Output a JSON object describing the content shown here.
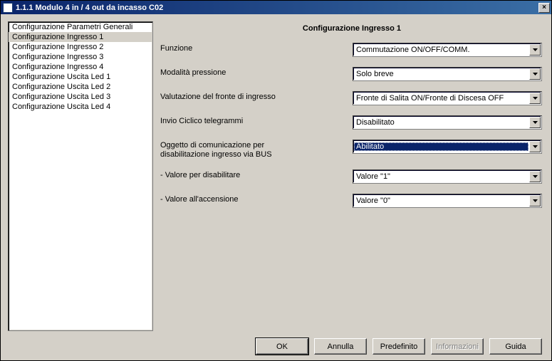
{
  "window": {
    "title": "1.1.1 Modulo 4 in / 4 out da incasso C02",
    "close_icon": "×"
  },
  "sidebar": {
    "selected_index": 1,
    "items": [
      "Configurazione Parametri Generali",
      "Configurazione Ingresso 1",
      "Configurazione Ingresso 2",
      "Configurazione Ingresso 3",
      "Configurazione Ingresso 4",
      "Configurazione Uscita Led 1",
      "Configurazione Uscita Led 2",
      "Configurazione Uscita Led 3",
      "Configurazione Uscita Led 4"
    ]
  },
  "panel": {
    "title": "Configurazione Ingresso 1",
    "rows": [
      {
        "label": "Funzione",
        "value": "Commutazione ON/OFF/COMM.",
        "highlight": false
      },
      {
        "label": "Modalità pressione",
        "value": "Solo breve",
        "highlight": false
      },
      {
        "label": "Valutazione del fronte di ingresso",
        "value": "Fronte di Salita ON/Fronte di Discesa OFF",
        "highlight": false
      },
      {
        "label": "Invio Ciclico telegrammi",
        "value": "Disabilitato",
        "highlight": false
      },
      {
        "label": "Oggetto di comunicazione per\ndisabilitazione ingresso via BUS",
        "value": "Abilitato",
        "highlight": true
      },
      {
        "label": "- Valore per disabilitare",
        "value": "Valore \"1\"",
        "highlight": false
      },
      {
        "label": "- Valore all'accensione",
        "value": "Valore \"0\"",
        "highlight": false
      }
    ]
  },
  "buttons": {
    "ok": "OK",
    "cancel": "Annulla",
    "default": "Predefinito",
    "info": "Informazioni",
    "help": "Guida"
  }
}
